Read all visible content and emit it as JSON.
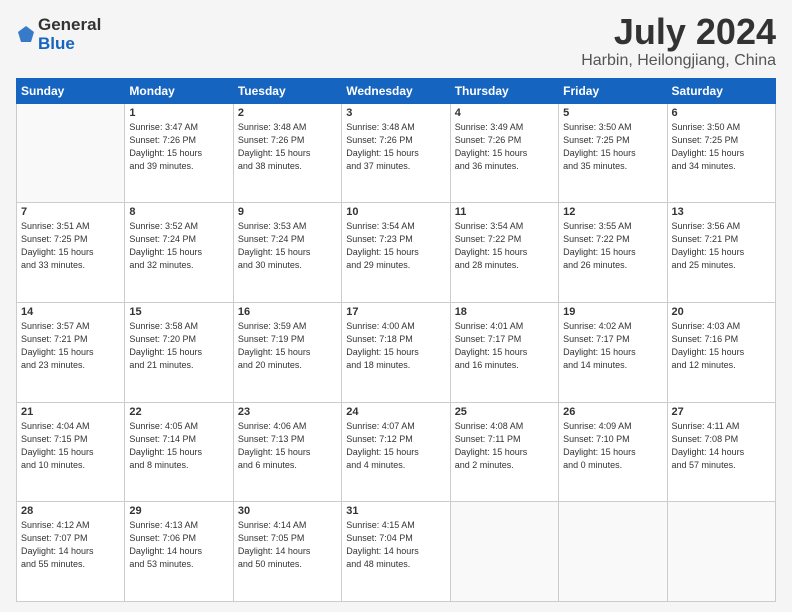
{
  "header": {
    "logo_line1": "General",
    "logo_line2": "Blue",
    "month": "July 2024",
    "location": "Harbin, Heilongjiang, China"
  },
  "weekdays": [
    "Sunday",
    "Monday",
    "Tuesday",
    "Wednesday",
    "Thursday",
    "Friday",
    "Saturday"
  ],
  "weeks": [
    [
      {
        "day": "",
        "info": ""
      },
      {
        "day": "1",
        "info": "Sunrise: 3:47 AM\nSunset: 7:26 PM\nDaylight: 15 hours\nand 39 minutes."
      },
      {
        "day": "2",
        "info": "Sunrise: 3:48 AM\nSunset: 7:26 PM\nDaylight: 15 hours\nand 38 minutes."
      },
      {
        "day": "3",
        "info": "Sunrise: 3:48 AM\nSunset: 7:26 PM\nDaylight: 15 hours\nand 37 minutes."
      },
      {
        "day": "4",
        "info": "Sunrise: 3:49 AM\nSunset: 7:26 PM\nDaylight: 15 hours\nand 36 minutes."
      },
      {
        "day": "5",
        "info": "Sunrise: 3:50 AM\nSunset: 7:25 PM\nDaylight: 15 hours\nand 35 minutes."
      },
      {
        "day": "6",
        "info": "Sunrise: 3:50 AM\nSunset: 7:25 PM\nDaylight: 15 hours\nand 34 minutes."
      }
    ],
    [
      {
        "day": "7",
        "info": "Sunrise: 3:51 AM\nSunset: 7:25 PM\nDaylight: 15 hours\nand 33 minutes."
      },
      {
        "day": "8",
        "info": "Sunrise: 3:52 AM\nSunset: 7:24 PM\nDaylight: 15 hours\nand 32 minutes."
      },
      {
        "day": "9",
        "info": "Sunrise: 3:53 AM\nSunset: 7:24 PM\nDaylight: 15 hours\nand 30 minutes."
      },
      {
        "day": "10",
        "info": "Sunrise: 3:54 AM\nSunset: 7:23 PM\nDaylight: 15 hours\nand 29 minutes."
      },
      {
        "day": "11",
        "info": "Sunrise: 3:54 AM\nSunset: 7:22 PM\nDaylight: 15 hours\nand 28 minutes."
      },
      {
        "day": "12",
        "info": "Sunrise: 3:55 AM\nSunset: 7:22 PM\nDaylight: 15 hours\nand 26 minutes."
      },
      {
        "day": "13",
        "info": "Sunrise: 3:56 AM\nSunset: 7:21 PM\nDaylight: 15 hours\nand 25 minutes."
      }
    ],
    [
      {
        "day": "14",
        "info": "Sunrise: 3:57 AM\nSunset: 7:21 PM\nDaylight: 15 hours\nand 23 minutes."
      },
      {
        "day": "15",
        "info": "Sunrise: 3:58 AM\nSunset: 7:20 PM\nDaylight: 15 hours\nand 21 minutes."
      },
      {
        "day": "16",
        "info": "Sunrise: 3:59 AM\nSunset: 7:19 PM\nDaylight: 15 hours\nand 20 minutes."
      },
      {
        "day": "17",
        "info": "Sunrise: 4:00 AM\nSunset: 7:18 PM\nDaylight: 15 hours\nand 18 minutes."
      },
      {
        "day": "18",
        "info": "Sunrise: 4:01 AM\nSunset: 7:17 PM\nDaylight: 15 hours\nand 16 minutes."
      },
      {
        "day": "19",
        "info": "Sunrise: 4:02 AM\nSunset: 7:17 PM\nDaylight: 15 hours\nand 14 minutes."
      },
      {
        "day": "20",
        "info": "Sunrise: 4:03 AM\nSunset: 7:16 PM\nDaylight: 15 hours\nand 12 minutes."
      }
    ],
    [
      {
        "day": "21",
        "info": "Sunrise: 4:04 AM\nSunset: 7:15 PM\nDaylight: 15 hours\nand 10 minutes."
      },
      {
        "day": "22",
        "info": "Sunrise: 4:05 AM\nSunset: 7:14 PM\nDaylight: 15 hours\nand 8 minutes."
      },
      {
        "day": "23",
        "info": "Sunrise: 4:06 AM\nSunset: 7:13 PM\nDaylight: 15 hours\nand 6 minutes."
      },
      {
        "day": "24",
        "info": "Sunrise: 4:07 AM\nSunset: 7:12 PM\nDaylight: 15 hours\nand 4 minutes."
      },
      {
        "day": "25",
        "info": "Sunrise: 4:08 AM\nSunset: 7:11 PM\nDaylight: 15 hours\nand 2 minutes."
      },
      {
        "day": "26",
        "info": "Sunrise: 4:09 AM\nSunset: 7:10 PM\nDaylight: 15 hours\nand 0 minutes."
      },
      {
        "day": "27",
        "info": "Sunrise: 4:11 AM\nSunset: 7:08 PM\nDaylight: 14 hours\nand 57 minutes."
      }
    ],
    [
      {
        "day": "28",
        "info": "Sunrise: 4:12 AM\nSunset: 7:07 PM\nDaylight: 14 hours\nand 55 minutes."
      },
      {
        "day": "29",
        "info": "Sunrise: 4:13 AM\nSunset: 7:06 PM\nDaylight: 14 hours\nand 53 minutes."
      },
      {
        "day": "30",
        "info": "Sunrise: 4:14 AM\nSunset: 7:05 PM\nDaylight: 14 hours\nand 50 minutes."
      },
      {
        "day": "31",
        "info": "Sunrise: 4:15 AM\nSunset: 7:04 PM\nDaylight: 14 hours\nand 48 minutes."
      },
      {
        "day": "",
        "info": ""
      },
      {
        "day": "",
        "info": ""
      },
      {
        "day": "",
        "info": ""
      }
    ]
  ]
}
